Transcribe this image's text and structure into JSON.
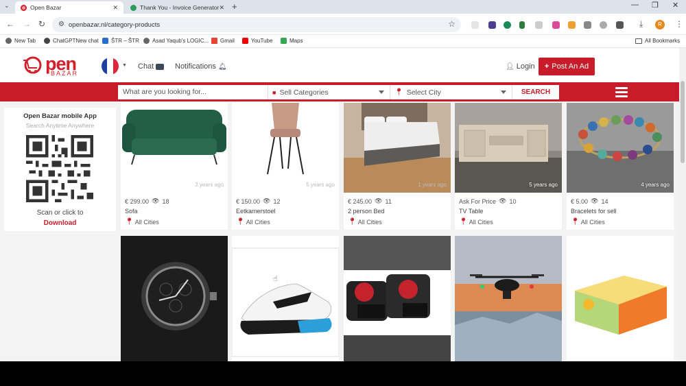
{
  "browser": {
    "tabs": [
      {
        "title": "Open Bazar",
        "active": true,
        "icon": "open-bazar-favicon"
      },
      {
        "title": "Thank You - Invoice Generator",
        "active": false,
        "icon": "invoice-generator-favicon"
      }
    ],
    "new_tab_symbol": "+",
    "url": "openbazar.nl/category-products",
    "bookmarks": [
      {
        "label": "New Tab",
        "icon": "globe-icon"
      },
      {
        "label": "ChatGPTNew chat",
        "icon": "chatgpt-icon"
      },
      {
        "label": "ŠTR – ŠTR",
        "icon": "bookmark-icon"
      },
      {
        "label": "Asad Yaqub's LOGIC...",
        "icon": "globe-icon"
      },
      {
        "label": "Gmail",
        "icon": "gmail-icon"
      },
      {
        "label": "YouTube",
        "icon": "youtube-icon"
      },
      {
        "label": "Maps",
        "icon": "maps-icon"
      }
    ],
    "all_bookmarks": "All Bookmarks",
    "profile_initial": "R"
  },
  "site": {
    "logo_word": "pen",
    "logo_sub": "BAZAR",
    "nav": {
      "chat": "Chat",
      "notifications": "Notifications"
    },
    "login": "Login",
    "post_ad": "Post An Ad",
    "search": {
      "placeholder": "What are you looking for...",
      "category": "Sell Categories",
      "city": "Select City",
      "button": "SEARCH"
    },
    "colors": {
      "brand_red": "#c81c2a"
    }
  },
  "sidebar": {
    "app_title": "Open Bazar mobile App",
    "app_subtitle": "Search Anytime Anywhere",
    "scan_text": "Scan or click to",
    "download": "Download"
  },
  "products": [
    {
      "price": "€ 299.00",
      "views": "18",
      "name": "Sofa",
      "city": "All Cities",
      "age": "3 years ago"
    },
    {
      "price": "€ 150.00",
      "views": "12",
      "name": "Eetkamerstoel",
      "city": "All Cities",
      "age": "5 years ago"
    },
    {
      "price": "€ 245.00",
      "views": "11",
      "name": "2 person Bed",
      "city": "All Cities",
      "age": "1 years ago"
    },
    {
      "price": "Ask For Price",
      "views": "10",
      "name": "TV Table",
      "city": "All Cities",
      "age": "5 years ago"
    },
    {
      "price": "€ 5.00",
      "views": "14",
      "name": "Bracelets for sell",
      "city": "All Cities",
      "age": "4 years ago"
    }
  ]
}
